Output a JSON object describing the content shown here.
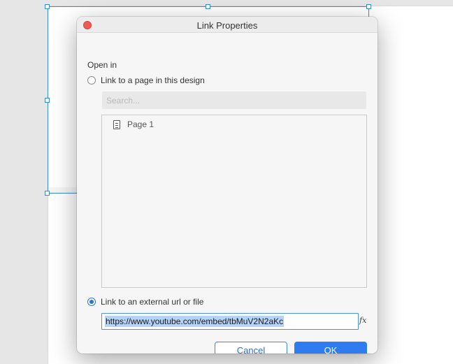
{
  "dialog": {
    "title": "Link Properties",
    "open_in_label": "Open in",
    "option_page": {
      "label": "Link to a page in this design",
      "selected": false
    },
    "search": {
      "placeholder": "Search..."
    },
    "pages": [
      {
        "label": "Page 1",
        "icon": "document-icon"
      }
    ],
    "option_url": {
      "label": "Link to an external url or file",
      "selected": true
    },
    "url_value": "https://www.youtube.com/embed/tbMuV2N2aKc",
    "fx_icon": "fx",
    "cancel_label": "Cancel",
    "ok_label": "OK"
  },
  "colors": {
    "accent": "#2f7bf0",
    "close": "#ee5a52",
    "selection": "#3b8bdc"
  }
}
